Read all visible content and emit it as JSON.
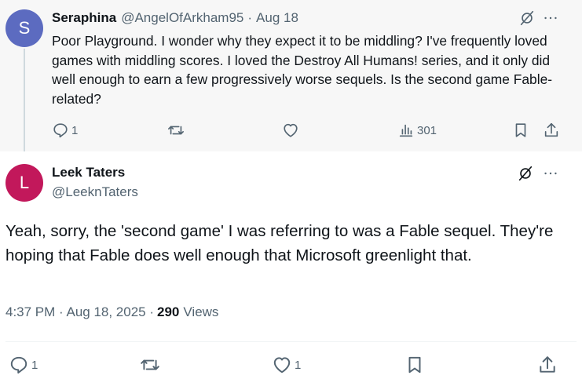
{
  "parent_tweet": {
    "avatar_letter": "S",
    "display_name": "Seraphina",
    "handle": "@AngelOfArkham95",
    "separator": "·",
    "date": "Aug 18",
    "text": "Poor Playground. I wonder why they expect it to be middling? I've frequently loved games with middling scores. I loved the Destroy All Humans! series, and it only did well enough to earn a few progressively worse sequels. Is the second game Fable-related?",
    "reply_count": "1",
    "view_count": "301"
  },
  "reply_tweet": {
    "avatar_letter": "L",
    "display_name": "Leek Taters",
    "handle": "@LeeknTaters",
    "text": "Yeah, sorry, the 'second game' I was referring to was a Fable sequel. They're hoping that Fable does well enough that Microsoft greenlight that.",
    "timestamp": "4:37 PM · Aug 18, 2025 ·",
    "views_count": "290",
    "views_label": "Views",
    "reply_count": "1",
    "like_count": "1"
  },
  "colors": {
    "parent_avatar": "#5c6bc0",
    "reply_avatar": "#c2185b",
    "muted_text": "#536471",
    "primary_text": "#0f1419"
  },
  "icons": [
    "grok-icon",
    "more-icon",
    "reply-icon",
    "retweet-icon",
    "like-icon",
    "analytics-icon",
    "bookmark-icon",
    "share-icon"
  ]
}
